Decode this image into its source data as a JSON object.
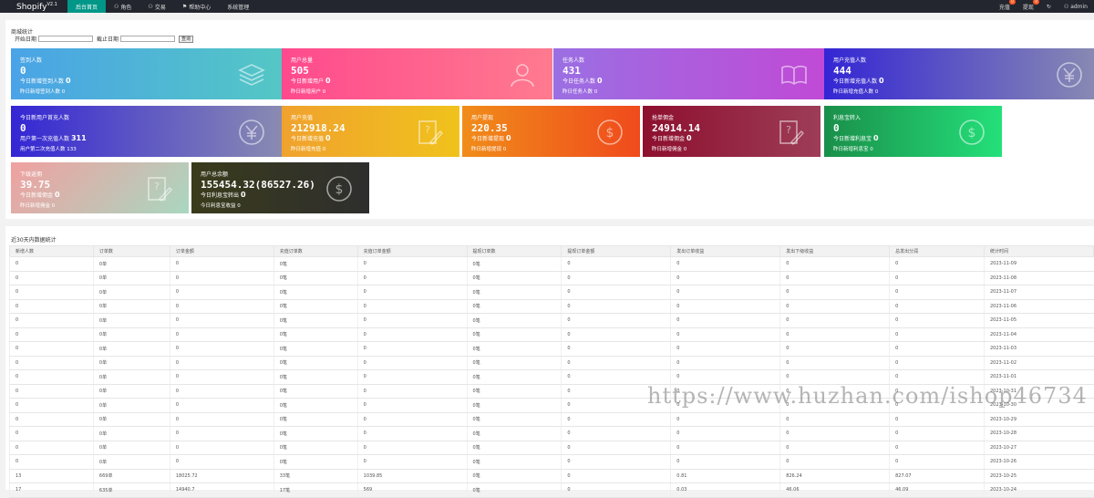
{
  "header": {
    "brand": "Shopify",
    "version": "V2.1",
    "nav": [
      {
        "label": "后台首页",
        "icon": ""
      },
      {
        "label": "角色",
        "icon": "user-icon"
      },
      {
        "label": "交易",
        "icon": "users-icon"
      },
      {
        "label": "帮助中心",
        "icon": "flag-icon"
      },
      {
        "label": "系统管理",
        "icon": ""
      }
    ],
    "right": {
      "recharge": "充值",
      "recharge_badge": "0",
      "withdraw": "提现",
      "withdraw_badge": "0",
      "refresh_icon": "refresh-icon",
      "user": "admin"
    }
  },
  "stats": {
    "title": "商城统计",
    "start_label": "开始日期",
    "end_label": "截止日期",
    "query_label": "查询",
    "cards": [
      {
        "title": "签到人数",
        "value": "0",
        "l1": "今日新增签到人数",
        "l1v": "0",
        "l2": "昨日新增签到人数",
        "l2v": "0",
        "icon": "layers-icon",
        "bg": "linear-gradient(90deg,#4aa3e6,#54c7c5)"
      },
      {
        "title": "用户总量",
        "value": "505",
        "l1": "今日新增用户",
        "l1v": "0",
        "l2": "昨日新增用户",
        "l2v": "0",
        "icon": "user-icon",
        "bg": "linear-gradient(90deg,#ff4a8d,#ff7a8f)"
      },
      {
        "title": "任务人数",
        "value": "431",
        "l1": "今日任务人数",
        "l1v": "0",
        "l2": "昨日任务人数",
        "l2v": "0",
        "icon": "book-icon",
        "bg": "linear-gradient(90deg,#9b6fe3,#c04ad6)"
      },
      {
        "title": "用户充值人数",
        "value": "444",
        "l1": "今日新增充值人数",
        "l1v": "0",
        "l2": "昨日新增充值人数",
        "l2v": "0",
        "icon": "yen-icon",
        "bg": "linear-gradient(90deg,#3426d4,#8a8bb2)"
      },
      {
        "title": "今日新用户首充人数",
        "value": "0",
        "l1": "用户第一次充值人数",
        "l1v": "311",
        "l2": "用户第二次充值人数",
        "l2v": "133",
        "icon": "yen-icon",
        "bg": "linear-gradient(90deg,#3426d4,#8a8bb2)"
      },
      {
        "title": "用户充值",
        "value": "212918.24",
        "l1": "今日新增充值",
        "l1v": "0",
        "l2": "昨日新增充值",
        "l2v": "0",
        "icon": "edit-icon",
        "bg": "linear-gradient(90deg,#f0a22e,#f0c21c)"
      },
      {
        "title": "用户提现",
        "value": "220.35",
        "l1": "今日新增提现",
        "l1v": "0",
        "l2": "昨日新增提现",
        "l2v": "0",
        "icon": "dollar-icon",
        "bg": "linear-gradient(90deg,#f08c1a,#f04a1c)"
      },
      {
        "title": "抢单佣金",
        "value": "24914.14",
        "l1": "今日新增佣金",
        "l1v": "0",
        "l2": "昨日新增佣金",
        "l2v": "0",
        "icon": "edit-icon",
        "bg": "linear-gradient(90deg,#8d0f2e,#9d3d57)"
      },
      {
        "title": "利息宝转入",
        "value": "0",
        "l1": "今日新增利息宝",
        "l1v": "0",
        "l2": "昨日新增利息宝",
        "l2v": "0",
        "icon": "dollar-icon",
        "bg": "linear-gradient(90deg,#1a8f4a,#24e07a)"
      },
      {
        "title": "下级返佣",
        "value": "39.75",
        "l1": "今日新增佣金",
        "l1v": "0",
        "l2": "昨日新增佣金",
        "l2v": "0",
        "icon": "edit-icon",
        "bg": "linear-gradient(135deg,#f0a0a0,#a9d7c0)"
      },
      {
        "title": "用户总余额",
        "value": "155454.32(86527.26)",
        "l1": "今日利息宝转出",
        "l1v": "0",
        "l2": "今日利息宝收益",
        "l2v": "0",
        "icon": "dollar-icon",
        "bg": "linear-gradient(90deg,#3a3b1c,#2e2e2e)"
      }
    ]
  },
  "table": {
    "title": "近30天内数据统计",
    "headers": [
      "新增人数",
      "订单数",
      "订单金额",
      "充值订单数",
      "充值订单金额",
      "提现订单数",
      "提现订单金额",
      "发出订单收益",
      "发出下级收益",
      "总发出分润",
      "统计时间"
    ],
    "rows": [
      [
        "0",
        "0单",
        "0",
        "0笔",
        "0",
        "0笔",
        "0",
        "0",
        "0",
        "0",
        "2023-11-09"
      ],
      [
        "0",
        "0单",
        "0",
        "0笔",
        "0",
        "0笔",
        "0",
        "0",
        "0",
        "0",
        "2023-11-08"
      ],
      [
        "0",
        "0单",
        "0",
        "0笔",
        "0",
        "0笔",
        "0",
        "0",
        "0",
        "0",
        "2023-11-07"
      ],
      [
        "0",
        "0单",
        "0",
        "0笔",
        "0",
        "0笔",
        "0",
        "0",
        "0",
        "0",
        "2023-11-06"
      ],
      [
        "0",
        "0单",
        "0",
        "0笔",
        "0",
        "0笔",
        "0",
        "0",
        "0",
        "0",
        "2023-11-05"
      ],
      [
        "0",
        "0单",
        "0",
        "0笔",
        "0",
        "0笔",
        "0",
        "0",
        "0",
        "0",
        "2023-11-04"
      ],
      [
        "0",
        "0单",
        "0",
        "0笔",
        "0",
        "0笔",
        "0",
        "0",
        "0",
        "0",
        "2023-11-03"
      ],
      [
        "0",
        "0单",
        "0",
        "0笔",
        "0",
        "0笔",
        "0",
        "0",
        "0",
        "0",
        "2023-11-02"
      ],
      [
        "0",
        "0单",
        "0",
        "0笔",
        "0",
        "0笔",
        "0",
        "0",
        "0",
        "0",
        "2023-11-01"
      ],
      [
        "0",
        "0单",
        "0",
        "0笔",
        "0",
        "0笔",
        "0",
        "0",
        "0",
        "0",
        "2023-10-31"
      ],
      [
        "0",
        "0单",
        "0",
        "0笔",
        "0",
        "0笔",
        "0",
        "0",
        "0",
        "0",
        "2023-10-30"
      ],
      [
        "0",
        "0单",
        "0",
        "0笔",
        "0",
        "0笔",
        "0",
        "0",
        "0",
        "0",
        "2023-10-29"
      ],
      [
        "0",
        "0单",
        "0",
        "0笔",
        "0",
        "0笔",
        "0",
        "0",
        "0",
        "0",
        "2023-10-28"
      ],
      [
        "0",
        "0单",
        "0",
        "0笔",
        "0",
        "0笔",
        "0",
        "0",
        "0",
        "0",
        "2023-10-27"
      ],
      [
        "0",
        "0单",
        "0",
        "0笔",
        "0",
        "0笔",
        "0",
        "0",
        "0",
        "0",
        "2023-10-26"
      ],
      [
        "13",
        "669单",
        "18025.72",
        "33笔",
        "1039.85",
        "0笔",
        "0",
        "0.81",
        "826.24",
        "827.07",
        "2023-10-25"
      ],
      [
        "17",
        "635单",
        "14940.7",
        "17笔",
        "569",
        "0笔",
        "0",
        "0.03",
        "46.06",
        "46.09",
        "2023-10-24"
      ]
    ]
  },
  "watermark": "https://www.huzhan.com/ishop46734"
}
